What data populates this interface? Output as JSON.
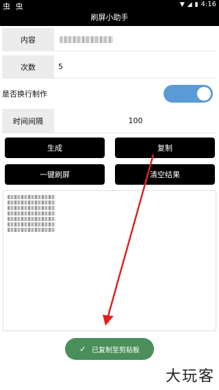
{
  "status_bar": {
    "left_icons": "虫 虫",
    "clock": "4:16",
    "signal_icon": "signal-icon",
    "wifi_icon": "wifi-icon",
    "battery_icon": "battery-icon"
  },
  "app": {
    "title": "刷屏小助手"
  },
  "form": {
    "content": {
      "label": "内容"
    },
    "count": {
      "label": "次数",
      "value": "5"
    },
    "newline": {
      "label": "是否换行制作",
      "enabled": true
    },
    "interval": {
      "label": "时间间隔",
      "value": "100"
    }
  },
  "buttons": {
    "generate": "生成",
    "copy": "复制",
    "one_click_refresh": "一键刷屏",
    "clear_result": "清空结果"
  },
  "toast": {
    "message": "已复制至剪贴板"
  },
  "watermark": {
    "logo_text": "大玩客"
  },
  "colors": {
    "toggle_on": "#5b9bd5",
    "toast_bg": "#4a8f5a",
    "arrow": "#e02020"
  }
}
